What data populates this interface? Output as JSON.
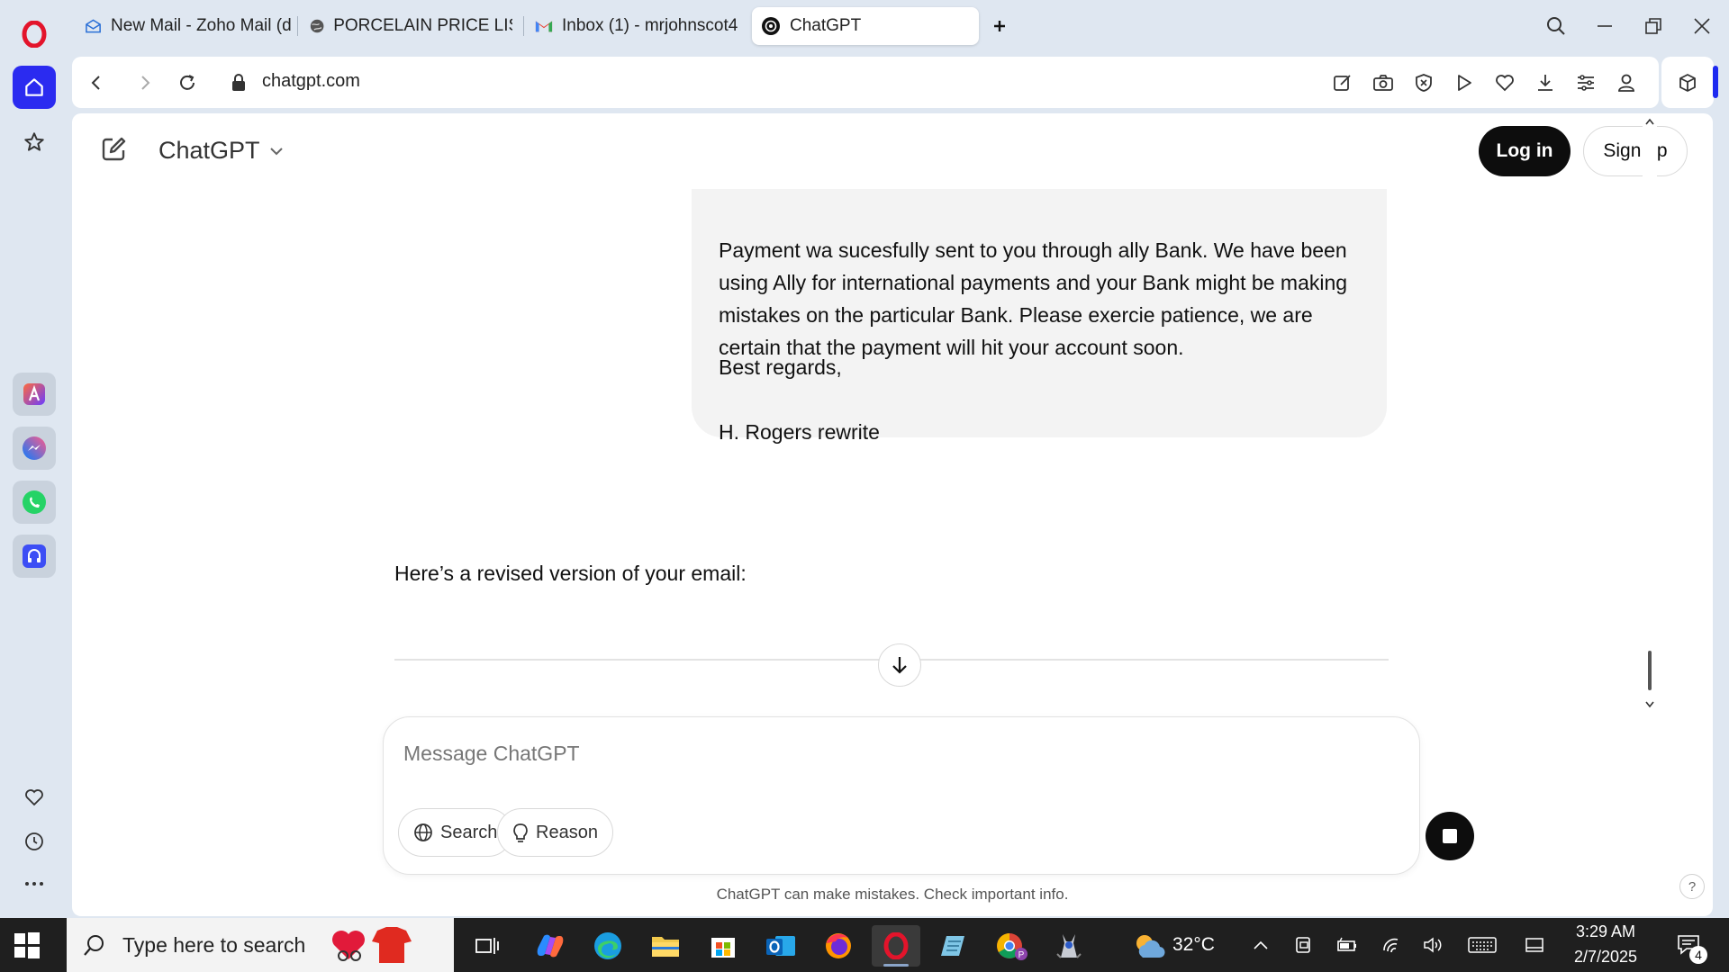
{
  "browser": {
    "tabs": [
      {
        "label": "New Mail - Zoho Mail (dir",
        "icon": "mail-icon"
      },
      {
        "label": "PORCELAIN PRICE LIST.xls",
        "icon": "globe-icon"
      },
      {
        "label": "Inbox (1) - mrjohnscot4@",
        "icon": "gmail-icon"
      },
      {
        "label": "ChatGPT",
        "icon": "chatgpt-icon"
      }
    ],
    "url": "chatgpt.com"
  },
  "chat": {
    "brand": "ChatGPT",
    "login": "Log in",
    "signup": "Sign up",
    "user_message": {
      "paragraph": "Payment wa sucesfully sent to you through ally Bank. We have been using Ally for international payments and your Bank might be making mistakes on the particular Bank. Please exercie patience, we are certain that the payment will hit your account soon.",
      "closing": "Best regards,",
      "signature": "H. Rogers rewrite"
    },
    "assistant_message": "Here’s a revised version of your email:",
    "composer": {
      "placeholder": "Message ChatGPT",
      "value": "",
      "search_label": "Search",
      "reason_label": "Reason"
    },
    "disclaimer": "ChatGPT can make mistakes. Check important info.",
    "help": "?"
  },
  "taskbar": {
    "search_placeholder": "Type here to search",
    "weather": "32°C",
    "time": "3:29 AM",
    "date": "2/7/2025",
    "notifications": "4"
  }
}
